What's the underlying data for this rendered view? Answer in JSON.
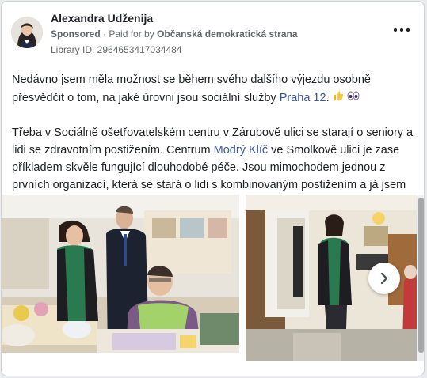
{
  "post": {
    "author_name": "Alexandra Udženija",
    "sponsored_label": "Sponsored",
    "paid_for_prefix": "Paid for by",
    "payer": "Občanská demokratická strana",
    "library_id": "Library ID: 2964653417034484",
    "paragraph1_part1": "Nedávno jsem měla možnost se během svého dalšího výjezdu osobně přesvědčit o tom, na jaké úrovni jsou sociální služby ",
    "paragraph1_link": "Praha 12",
    "paragraph1_part2": ".",
    "paragraph2_part1": "Třeba v Sociálně ošetřovatelském centru v Zárubově ulici se starají o seniory a lidi se zdravotním postižením. Centrum ",
    "paragraph2_link": "Modrý Klíč",
    "paragraph2_part2": " ve Smolkově ulici je zase příkladem skvěle fungující dlouhodobé péče. Jsou mimochodem jednou z prvních organizací, která se stará o lidi s kombinovaným postižením a já jsem moc ráda, že je v tom…"
  },
  "icons": {
    "more": "more-options-icon",
    "next": "chevron-right-icon",
    "emoji1": "thumbs-up-emoji",
    "emoji2": "eyes-emoji"
  },
  "colors": {
    "link": "#385898",
    "secondary_text": "#65676b"
  }
}
